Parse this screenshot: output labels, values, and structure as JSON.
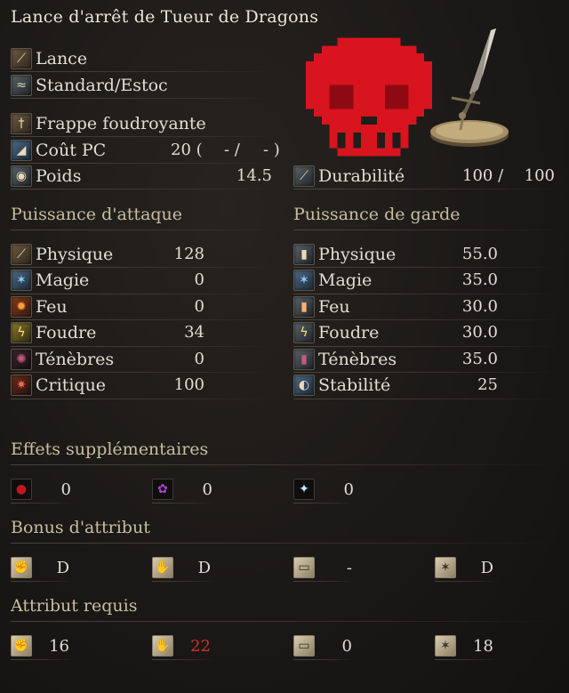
{
  "weapon_name": "Lance d'arrêt de Tueur de Dragons",
  "info": {
    "type": "Lance",
    "attack_type": "Standard/Estoc",
    "skill": "Frappe foudroyante",
    "fp_cost_label": "Coût PC",
    "fp_cost_value": "20 (",
    "fp_cost_mid": "- /",
    "fp_cost_end": "- )",
    "weight_label": "Poids",
    "weight_value": "14.5",
    "durability_label": "Durabilité",
    "durability_current": "100 /",
    "durability_max": "100"
  },
  "attack": {
    "header": "Puissance d'attaque",
    "rows": [
      {
        "label": "Physique",
        "value": "128"
      },
      {
        "label": "Magie",
        "value": "0"
      },
      {
        "label": "Feu",
        "value": "0"
      },
      {
        "label": "Foudre",
        "value": "34"
      },
      {
        "label": "Ténèbres",
        "value": "0"
      },
      {
        "label": "Critique",
        "value": "100"
      }
    ]
  },
  "guard": {
    "header": "Puissance de garde",
    "rows": [
      {
        "label": "Physique",
        "value": "55.0"
      },
      {
        "label": "Magie",
        "value": "35.0"
      },
      {
        "label": "Feu",
        "value": "30.0"
      },
      {
        "label": "Foudre",
        "value": "30.0"
      },
      {
        "label": "Ténèbres",
        "value": "35.0"
      },
      {
        "label": "Stabilité",
        "value": "25"
      }
    ]
  },
  "effects": {
    "header": "Effets supplémentaires",
    "values": [
      "0",
      "0",
      "0"
    ]
  },
  "scaling": {
    "header": "Bonus d'attribut",
    "values": [
      "D",
      "D",
      "-",
      "D"
    ]
  },
  "requirements": {
    "header": "Attribut requis",
    "values": [
      "16",
      "22",
      "0",
      "18"
    ],
    "highlight_color": "#d0302c"
  }
}
